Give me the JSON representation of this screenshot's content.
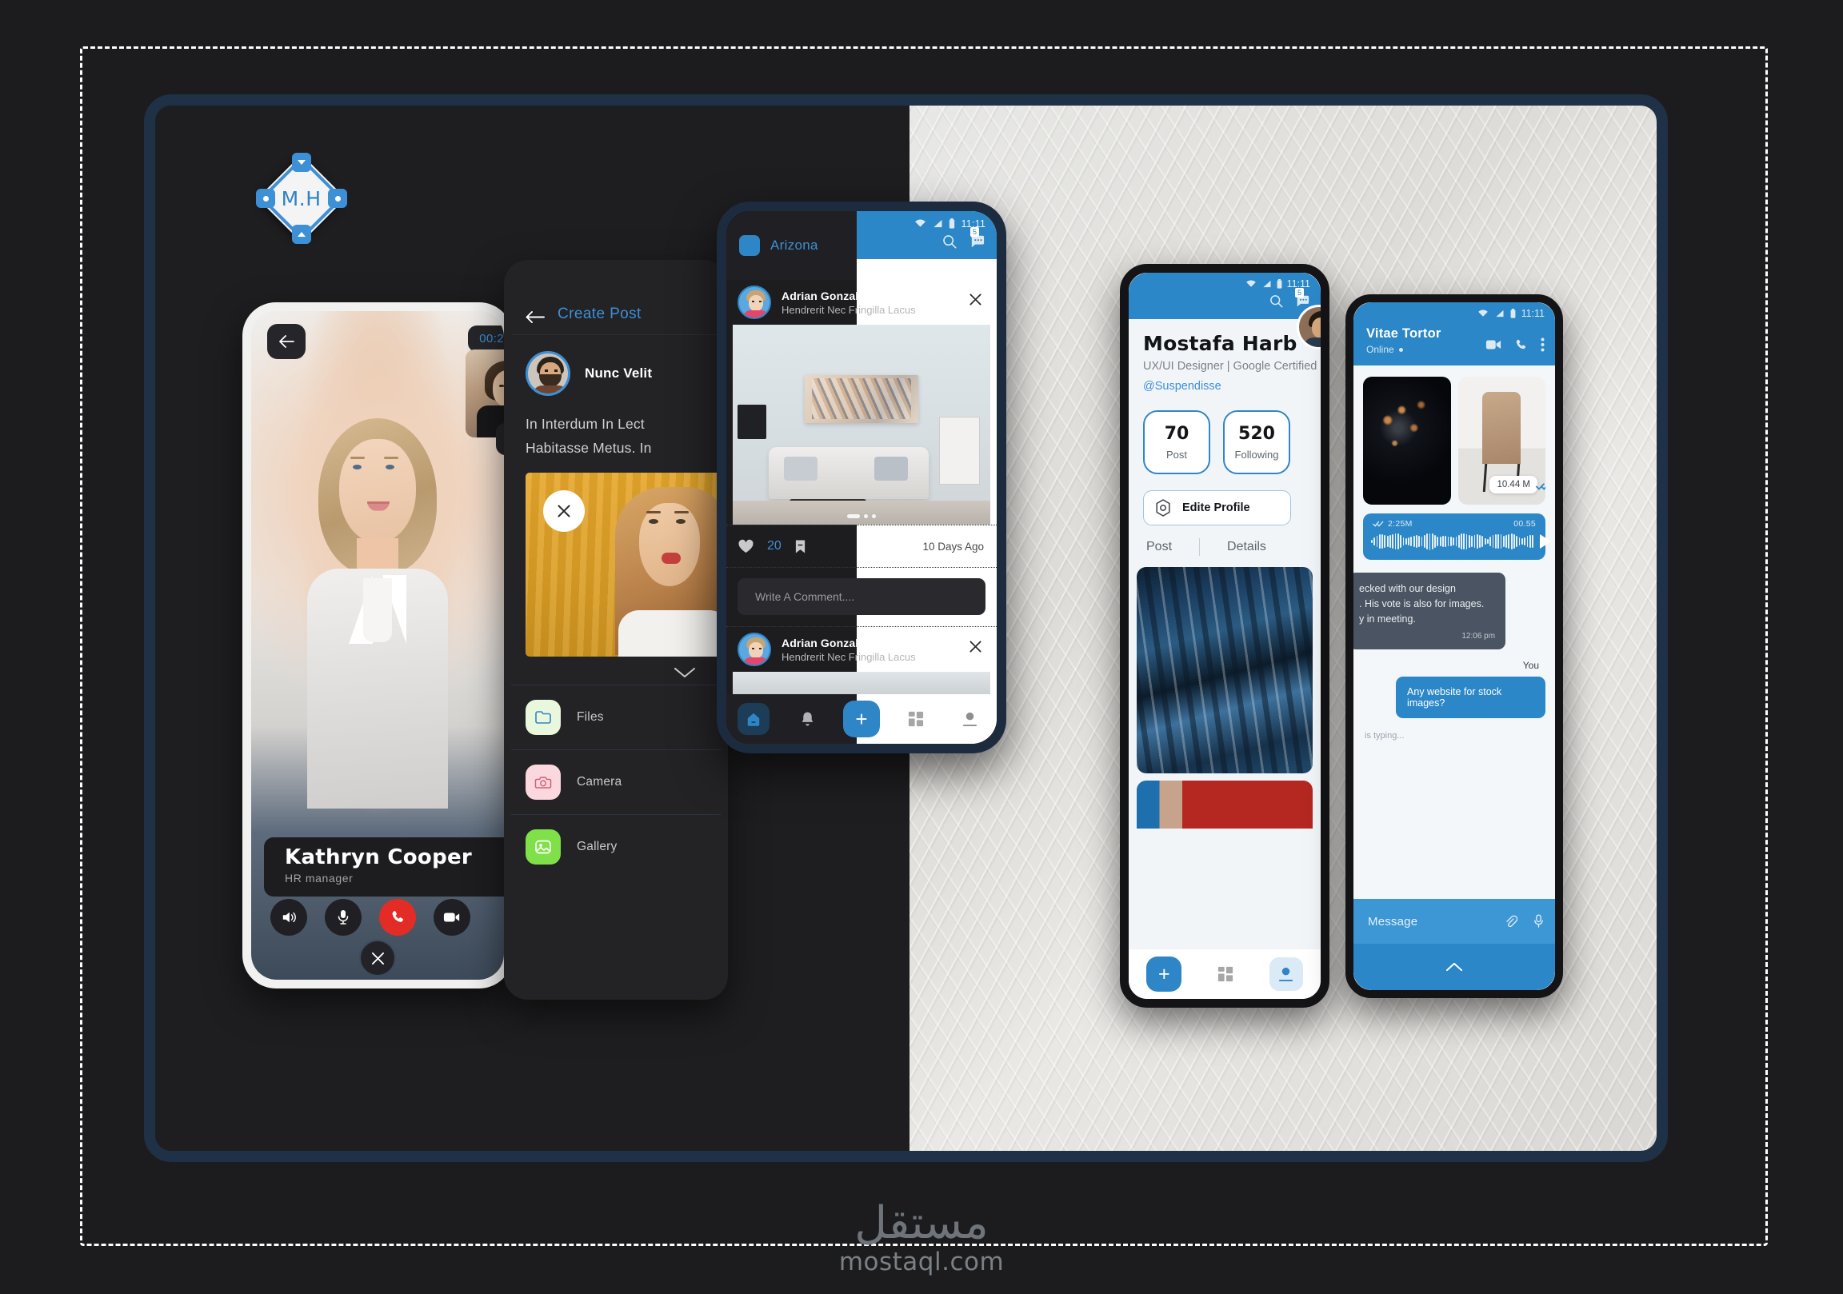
{
  "logo": {
    "initials": "M.H"
  },
  "video_call": {
    "back_icon": "arrow-left-icon",
    "timer": "00:2",
    "flip_icon": "camera-flip-icon",
    "name": "Kathryn Cooper",
    "role": "HR manager",
    "actions": [
      {
        "name": "speaker",
        "icon": "speaker-icon"
      },
      {
        "name": "microphone",
        "icon": "microphone-icon"
      },
      {
        "name": "hangup",
        "icon": "phone-icon",
        "color": "#e32c26"
      },
      {
        "name": "camera",
        "icon": "video-camera-icon"
      }
    ],
    "close_icon": "close-icon"
  },
  "create_post": {
    "back_icon": "arrow-left-icon",
    "title": "Create Post",
    "user": "Nunc Velit",
    "body": "In Interdum In Lect Habitasse Metus. In",
    "photo_remove_icon": "close-icon",
    "collapse_icon": "chevron-down-icon",
    "options": [
      {
        "label": "Files",
        "icon": "folder-icon"
      },
      {
        "label": "Camera",
        "icon": "camera-icon"
      },
      {
        "label": "Gallery",
        "icon": "image-icon"
      }
    ]
  },
  "feed": {
    "app_name": "Arizona",
    "status": {
      "time": "11:11",
      "wifi_icon": "wifi-icon",
      "signal_icon": "signal-icon",
      "battery_icon": "battery-icon"
    },
    "search_icon": "search-icon",
    "chat_icon": "chat-icon",
    "chat_badge": "5",
    "posts": [
      {
        "name": "Adrian Gonzale",
        "subtitle": "Hendrerit Nec Fringilla Lacus",
        "close_icon": "close-icon",
        "likes": "20",
        "like_icon": "heart-icon",
        "bookmark_icon": "bookmark-icon",
        "time": "10 Days Ago",
        "comment_placeholder": "Write A Comment...."
      },
      {
        "name": "Adrian Gonzale",
        "subtitle": "Hendrerit Nec Fringilla Lacus",
        "close_icon": "close-icon"
      }
    ],
    "nav": [
      {
        "name": "home",
        "icon": "home-icon",
        "active": true
      },
      {
        "name": "notifications",
        "icon": "bell-icon",
        "active": false
      },
      {
        "name": "add",
        "icon": "plus-icon",
        "active": false
      },
      {
        "name": "grid",
        "icon": "grid-icon",
        "active": false
      },
      {
        "name": "profile",
        "icon": "person-icon",
        "active": false
      }
    ]
  },
  "profile": {
    "status": {
      "time": "11:11"
    },
    "search_icon": "search-icon",
    "chat_icon": "chat-icon",
    "chat_badge": "5",
    "name": "Mostafa Harb",
    "role": "UX/UI Designer | Google Certified",
    "handle": "@Suspendisse",
    "stats": [
      {
        "value": "70",
        "label": "Post"
      },
      {
        "value": "520",
        "label": "Following"
      }
    ],
    "edit_button": {
      "label": "Edite Profile",
      "icon": "hexagon-settings-icon"
    },
    "tabs": [
      {
        "label": "Post"
      },
      {
        "label": "Details"
      }
    ],
    "nav": [
      {
        "name": "add",
        "icon": "plus-icon",
        "active": false
      },
      {
        "name": "grid",
        "icon": "grid-icon",
        "active": false
      },
      {
        "name": "profile",
        "icon": "person-icon",
        "active": true
      }
    ]
  },
  "chat": {
    "status": {
      "time": "11:11"
    },
    "name": "Vitae Tortor",
    "presence": "Online",
    "header_icons": [
      {
        "name": "video-call",
        "icon": "video-camera-icon"
      },
      {
        "name": "voice-call",
        "icon": "phone-icon"
      },
      {
        "name": "more",
        "icon": "more-vertical-icon"
      }
    ],
    "image_size_badge": "10.44 M",
    "delivered_icon": "double-check-icon",
    "voice_message": {
      "size": "2:25M",
      "duration": "00.55",
      "play_icon": "play-icon",
      "status_icon": "double-check-icon"
    },
    "incoming_message": "ecked with our design\n. His vote is also for images.\ny in meeting.",
    "incoming_time": "12:06 pm",
    "you_label": "You",
    "outgoing_message": "Any website for stock images?",
    "typing": "is typing...",
    "input_placeholder": "Message",
    "attach_icon": "attachment-icon",
    "mic_icon": "microphone-icon",
    "expand_icon": "chevron-up-icon"
  },
  "watermark": {
    "arabic": "مستقل",
    "latin": "mostaql.com"
  },
  "colors": {
    "accent": "#2f86c6",
    "danger": "#e32c26",
    "dark_panel": "#1e1e20",
    "navy": "#1e3146"
  }
}
